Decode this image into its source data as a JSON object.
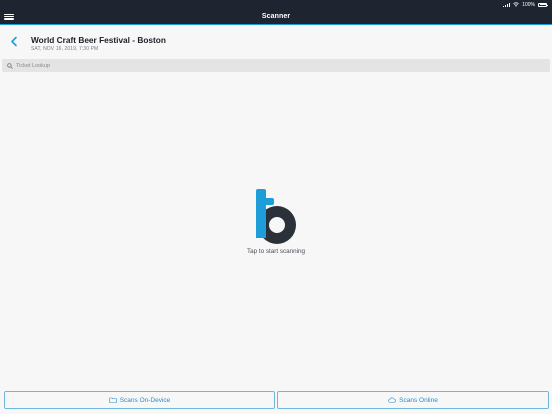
{
  "status_bar": {
    "battery": "100%"
  },
  "nav": {
    "title": "Scanner"
  },
  "event": {
    "title": "World Craft Beer Festival - Boston",
    "date": "SAT, NOV 16, 2019, 7:30 PM"
  },
  "search": {
    "placeholder": "Ticket Lookup"
  },
  "scan": {
    "prompt": "Tap to start scanning"
  },
  "buttons": {
    "on_device": "Scans On-Device",
    "online": "Scans Online"
  },
  "colors": {
    "nav_bg": "#1e2530",
    "accent": "#1e9ed9",
    "logo_dark": "#2b3139"
  }
}
